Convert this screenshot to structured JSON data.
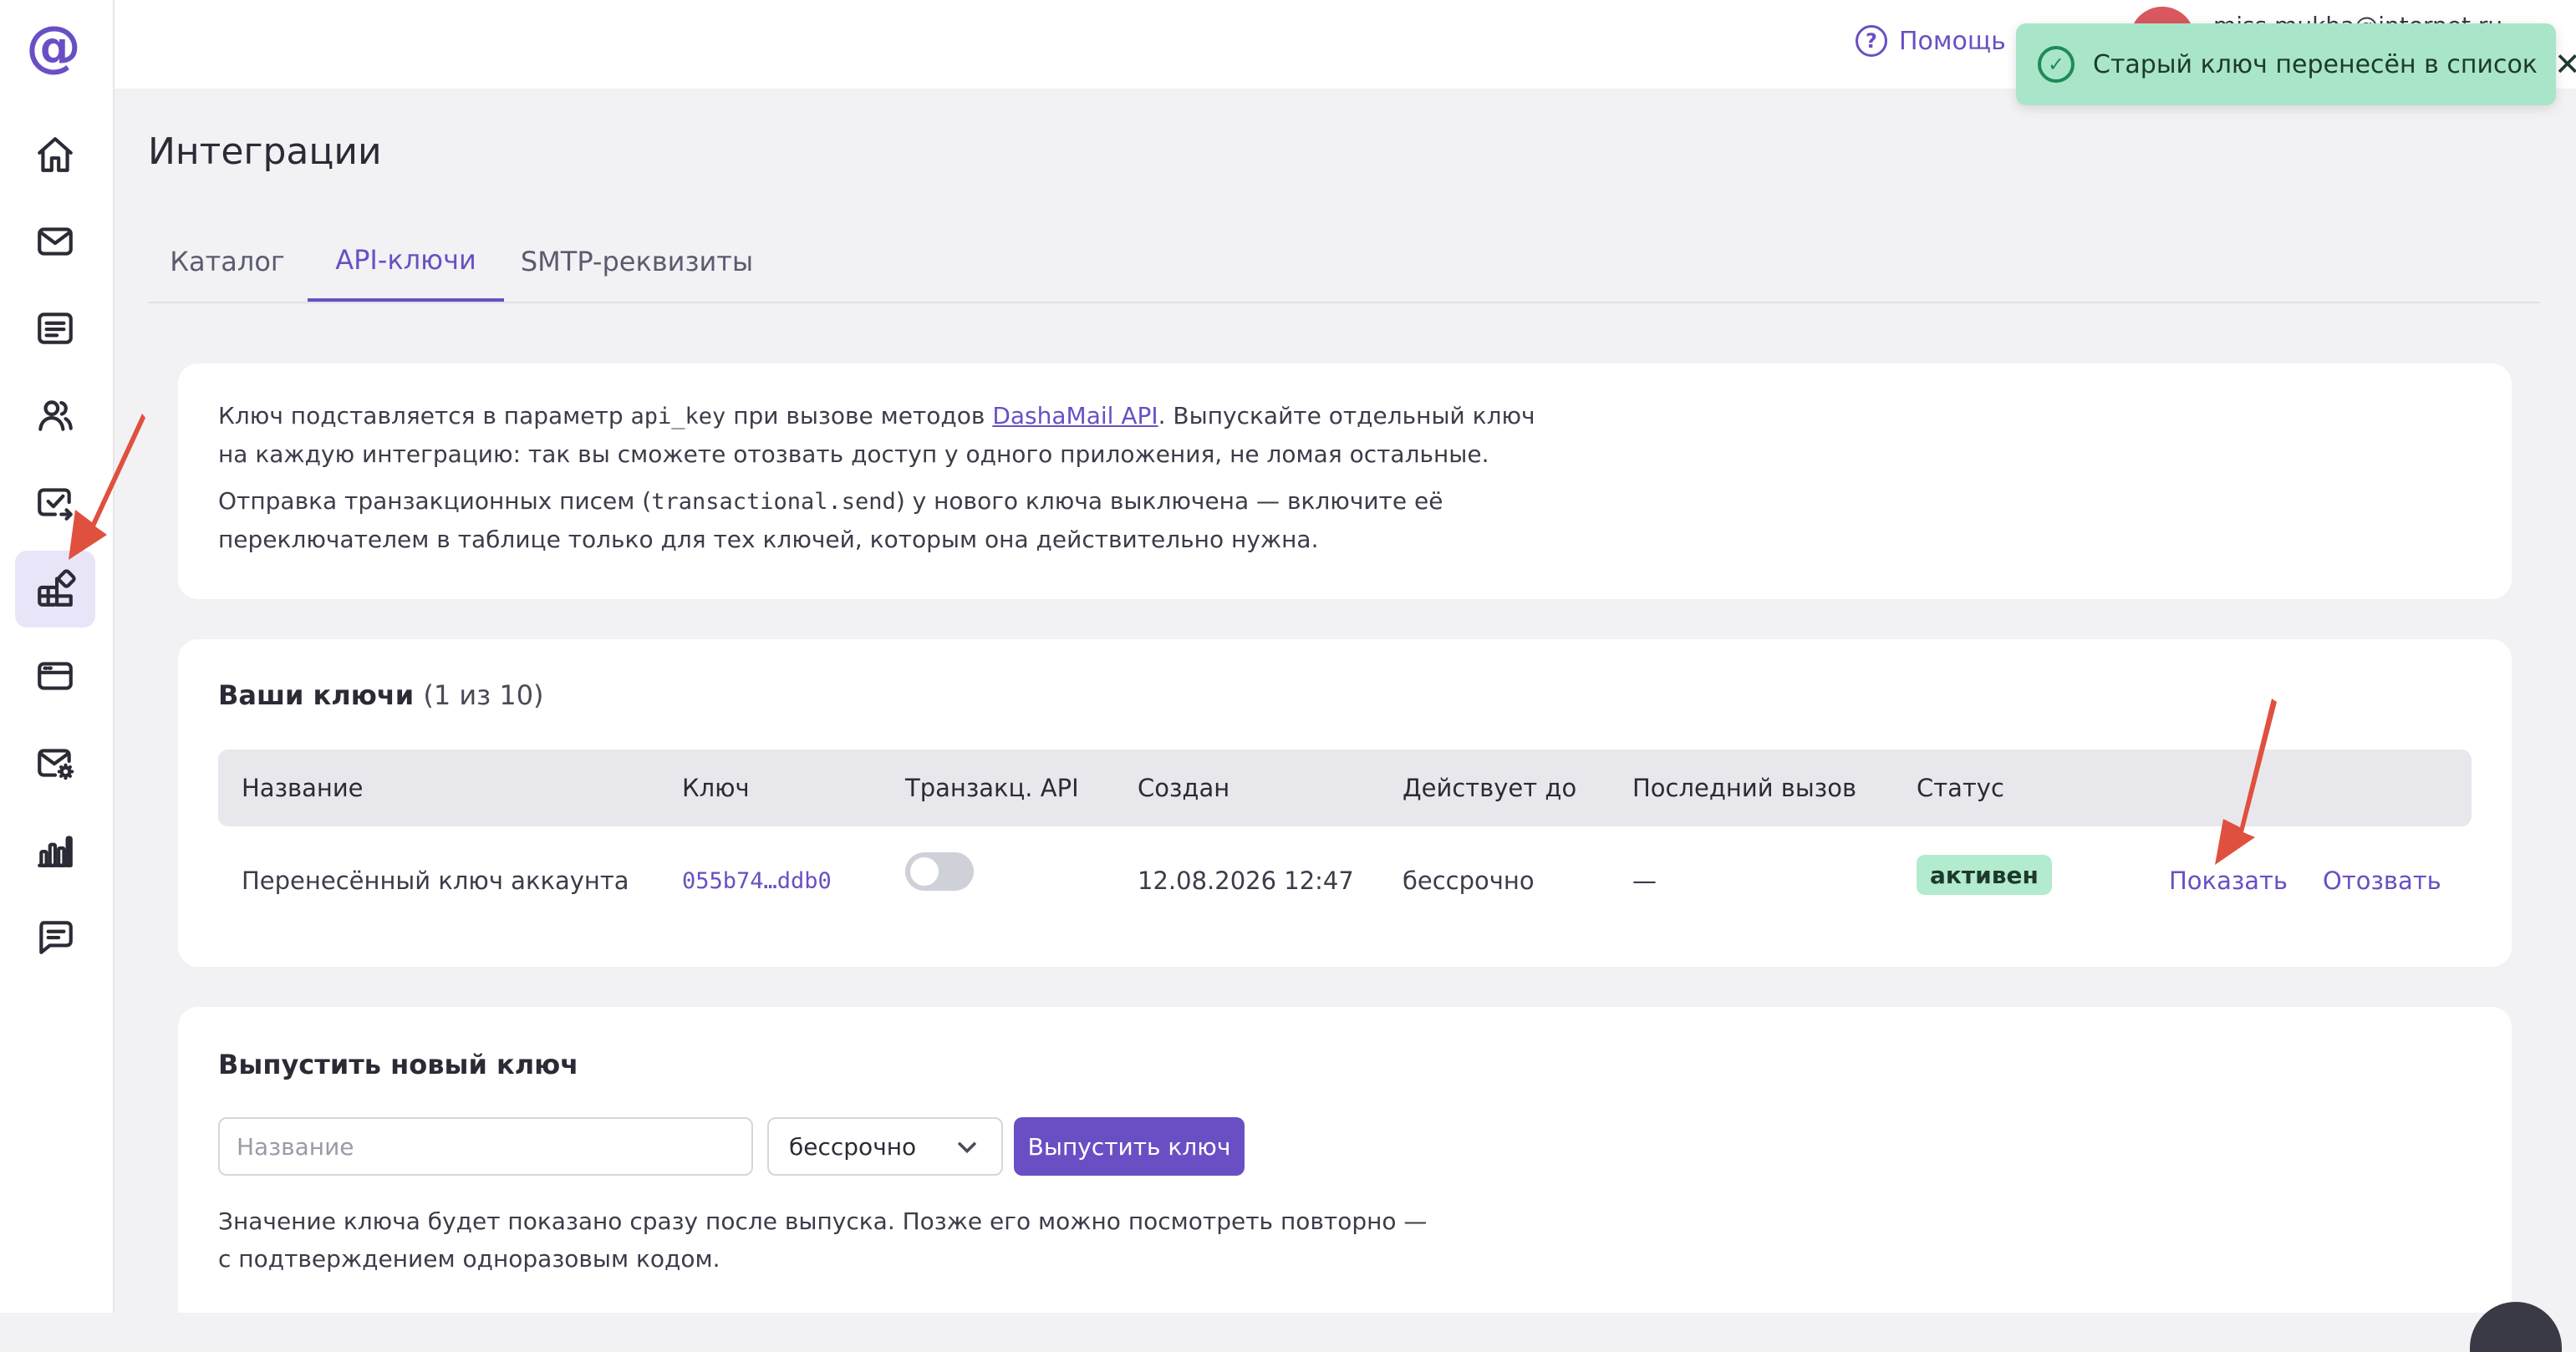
{
  "app": {
    "logo_glyph": "@",
    "accent_color": "#6a4fc4"
  },
  "sidebar": {
    "items": [
      {
        "name": "home",
        "icon": "home-icon",
        "active": false
      },
      {
        "name": "mail",
        "icon": "envelope-icon",
        "active": false
      },
      {
        "name": "templates",
        "icon": "document-list-icon",
        "active": false
      },
      {
        "name": "contacts",
        "icon": "users-icon",
        "active": false
      },
      {
        "name": "tasks",
        "icon": "mail-check-icon",
        "active": false
      },
      {
        "name": "integrations",
        "icon": "integrations-icon",
        "active": true
      },
      {
        "name": "billing",
        "icon": "card-icon",
        "active": false
      },
      {
        "name": "automation",
        "icon": "mail-gear-icon",
        "active": false
      },
      {
        "name": "analytics",
        "icon": "bar-chart-icon",
        "active": false
      },
      {
        "name": "support",
        "icon": "chat-icon",
        "active": false
      }
    ]
  },
  "topbar": {
    "help_label": "Помощь",
    "user_email": "miss.mukha@internet.ru"
  },
  "toast": {
    "message": "Старый ключ перенесён в список",
    "close_glyph": "✕",
    "check_glyph": "✓"
  },
  "page": {
    "title": "Интеграции",
    "tabs": [
      {
        "label": "Каталог",
        "active": false
      },
      {
        "label": "API-ключи",
        "active": true
      },
      {
        "label": "SMTP-реквизиты",
        "active": false
      }
    ]
  },
  "info": {
    "p1_a": "Ключ подставляется в параметр ",
    "p1_code": "api_key",
    "p1_b": " при вызове методов ",
    "p1_link": "DashaMail API",
    "p1_c": ". Выпускайте отдельный ключ на каждую интеграцию: так вы сможете отозвать доступ у одного приложения, не ломая остальные.",
    "p2_a": "Отправка транзакционных писем (",
    "p2_code": "transactional.send",
    "p2_b": ") у нового ключа выключена — включите её переключателем в таблице только для тех ключей, которым она действительно нужна."
  },
  "keys": {
    "title": "Ваши ключи",
    "count": "(1 из 10)",
    "columns": [
      "Название",
      "Ключ",
      "Транзакц. API",
      "Создан",
      "Действует до",
      "Последний вызов",
      "Статус"
    ],
    "rows": [
      {
        "name": "Перенесённый ключ аккаунта",
        "key": "055b74…ddb0",
        "transactional_enabled": false,
        "created": "12.08.2026 12:47",
        "valid_until": "бессрочно",
        "last_call": "—",
        "status": "активен",
        "show_label": "Показать",
        "revoke_label": "Отозвать"
      }
    ]
  },
  "new_key": {
    "title": "Выпустить новый ключ",
    "name_placeholder": "Название",
    "name_value": "",
    "term_selected": "бессрочно",
    "submit_label": "Выпустить ключ",
    "hint": "Значение ключа будет показано сразу после выпуска. Позже его можно посмотреть повторно — с подтверждением одноразовым кодом."
  }
}
